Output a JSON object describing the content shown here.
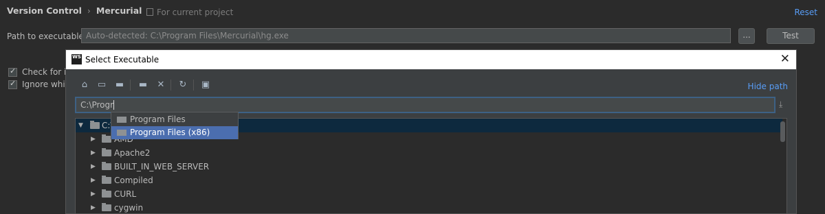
{
  "header": {
    "breadcrumb": [
      "Version Control",
      "Mercurial"
    ],
    "for_project": "For current project",
    "reset": "Reset"
  },
  "settings": {
    "path_label": "Path to executable",
    "path_value": "Auto-detected: C:\\Program Files\\Mercurial\\hg.exe",
    "browse_label": "...",
    "test_label": "Test",
    "checkboxes": [
      {
        "label": "Check for in",
        "checked": true
      },
      {
        "label": "Ignore whit",
        "checked": true
      }
    ]
  },
  "dialog": {
    "title": "Select Executable",
    "logo": "WS",
    "hide_path": "Hide path",
    "path_input": "C:\\Progr",
    "toolbar_icons": [
      "home-icon",
      "desktop-icon",
      "folder-icon",
      "new-folder-icon",
      "delete-icon",
      "refresh-icon",
      "show-hidden-icon"
    ],
    "autocomplete": [
      {
        "label": "Program Files",
        "selected": false
      },
      {
        "label": "Program Files (x86)",
        "selected": true
      }
    ],
    "tree": {
      "root": "C:\\",
      "items": [
        "AMD",
        "Apache2",
        "BUILT_IN_WEB_SERVER",
        "Compiled",
        "CURL",
        "cygwin"
      ]
    }
  }
}
